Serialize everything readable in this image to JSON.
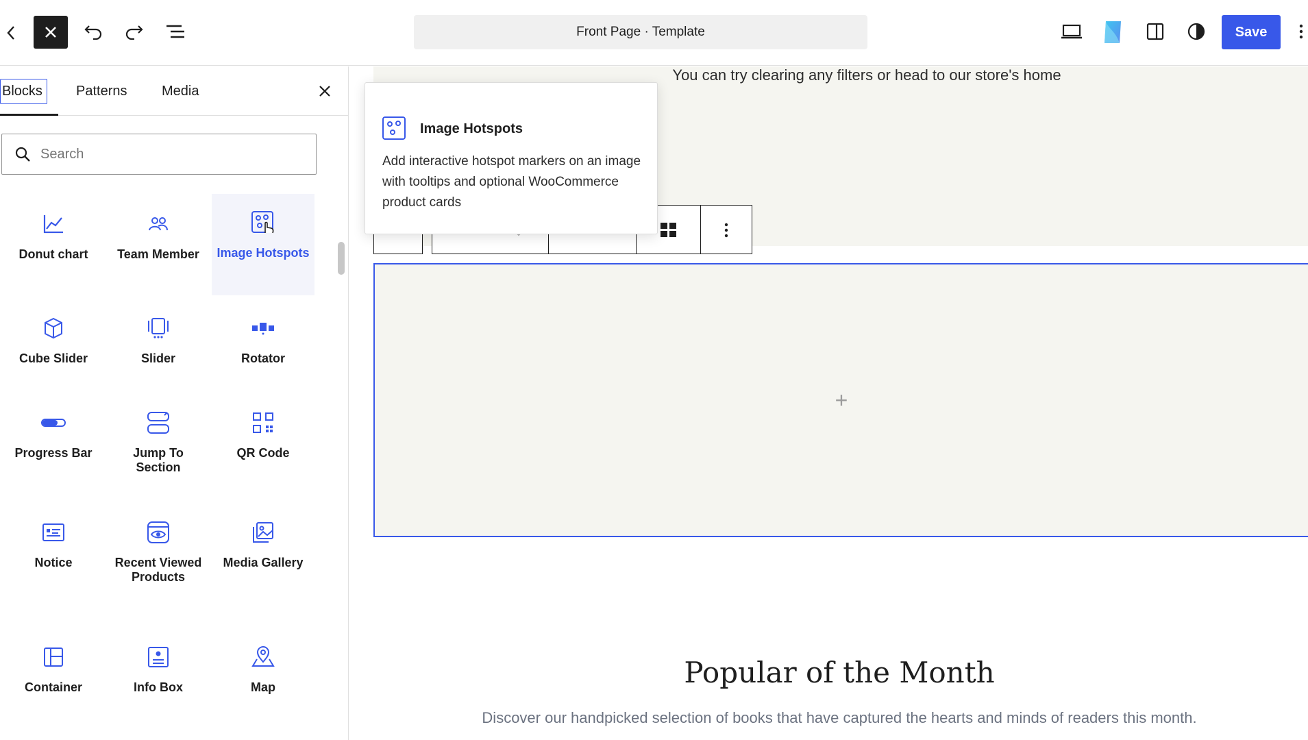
{
  "header": {
    "doc_title": "Front Page · Template",
    "save_label": "Save"
  },
  "sidebar": {
    "tabs": [
      {
        "label": "Blocks"
      },
      {
        "label": "Patterns"
      },
      {
        "label": "Media"
      }
    ],
    "search_placeholder": "Search",
    "blocks": [
      {
        "label": "Donut chart",
        "icon": "line-chart-icon"
      },
      {
        "label": "Team Member",
        "icon": "team-icon"
      },
      {
        "label": "Image Hotspots",
        "icon": "image-hotspots-icon",
        "active": true
      },
      {
        "label": "Cube Slider",
        "icon": "cube-icon"
      },
      {
        "label": "Slider",
        "icon": "slider-icon"
      },
      {
        "label": "Rotator",
        "icon": "rotator-icon"
      },
      {
        "label": "Progress Bar",
        "icon": "progress-bar-icon"
      },
      {
        "label": "Jump To Section",
        "icon": "jump-section-icon"
      },
      {
        "label": "QR Code",
        "icon": "qr-code-icon"
      },
      {
        "label": "Notice",
        "icon": "notice-icon"
      },
      {
        "label": "Recent Viewed Products",
        "icon": "recent-products-icon"
      },
      {
        "label": "Media Gallery",
        "icon": "media-gallery-icon"
      },
      {
        "label": "Container",
        "icon": "container-icon"
      },
      {
        "label": "Info Box",
        "icon": "info-box-icon"
      },
      {
        "label": "Map",
        "icon": "map-pin-icon"
      }
    ]
  },
  "popover": {
    "title": "Image Hotspots",
    "description": "Add interactive hotspot markers on an image with tooltips and optional WooCommerce product cards"
  },
  "canvas": {
    "top_message": "You can try clearing any filters or head to our store's home",
    "section_title": "Popular of the Month",
    "section_subtitle": "Discover our handpicked selection of books that have captured the hearts and minds of readers this month."
  },
  "colors": {
    "accent": "#3858e9",
    "dark": "#1e1e1e",
    "canvas_bg": "#f5f5f0"
  }
}
